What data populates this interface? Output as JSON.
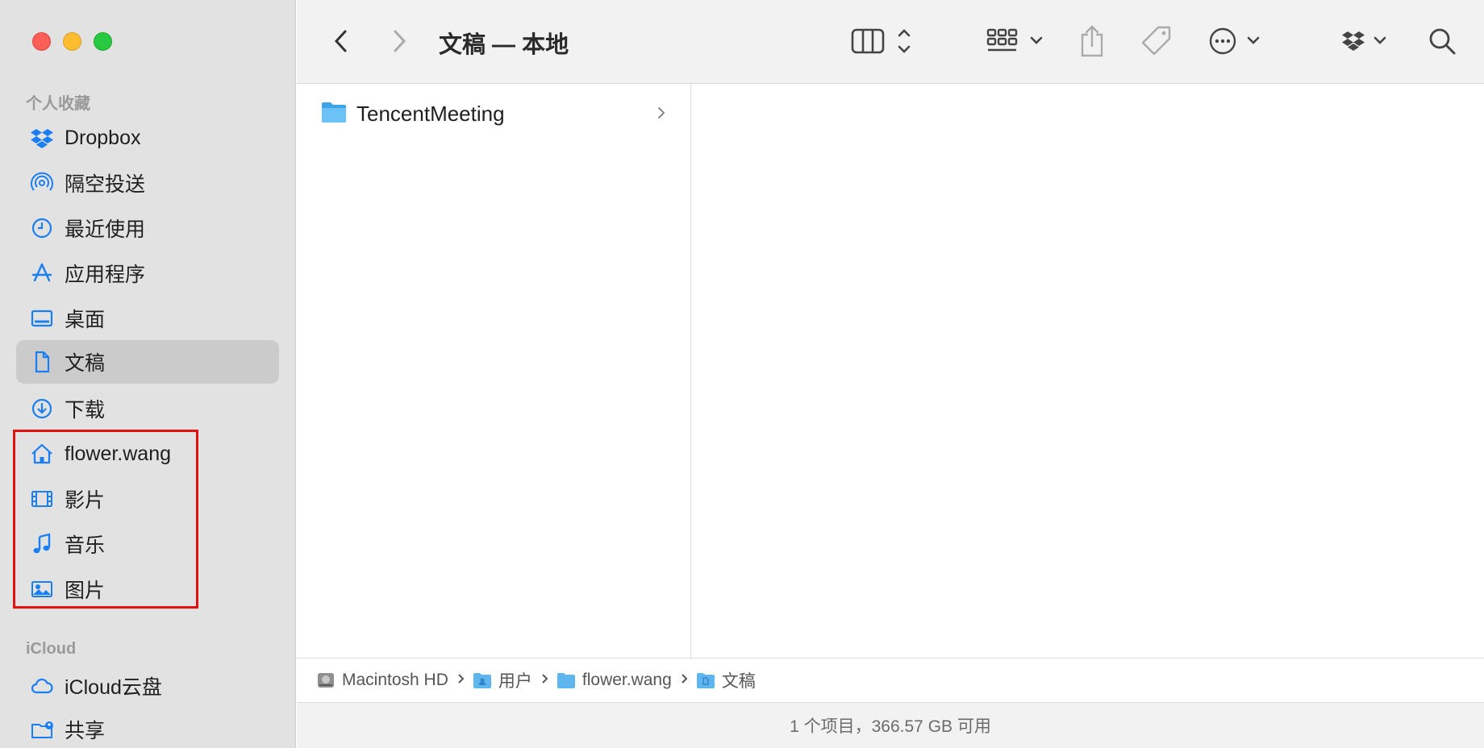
{
  "window": {
    "title": "文稿 — 本地"
  },
  "sidebar": {
    "favorites_title": "个人收藏",
    "favorites": [
      {
        "label": "Dropbox",
        "icon": "dropbox-icon"
      },
      {
        "label": "隔空投送",
        "icon": "airdrop-icon"
      },
      {
        "label": "最近使用",
        "icon": "clock-icon"
      },
      {
        "label": "应用程序",
        "icon": "apps-icon"
      },
      {
        "label": "桌面",
        "icon": "desktop-icon"
      },
      {
        "label": "文稿",
        "icon": "document-icon",
        "selected": true
      },
      {
        "label": "下载",
        "icon": "download-icon"
      },
      {
        "label": "flower.wang",
        "icon": "home-icon"
      },
      {
        "label": "影片",
        "icon": "film-icon"
      },
      {
        "label": "音乐",
        "icon": "music-icon"
      },
      {
        "label": "图片",
        "icon": "photo-icon"
      }
    ],
    "icloud_title": "iCloud",
    "icloud": [
      {
        "label": "iCloud云盘",
        "icon": "cloud-icon"
      },
      {
        "label": "共享",
        "icon": "shared-folder-icon"
      }
    ]
  },
  "content": {
    "items": [
      {
        "name": "TencentMeeting",
        "icon": "folder-icon"
      }
    ]
  },
  "pathbar": {
    "crumbs": [
      "Macintosh HD",
      "用户",
      "flower.wang",
      "文稿"
    ]
  },
  "status": {
    "text": "1 个项目，366.57 GB 可用"
  },
  "colors": {
    "accent": "#1a7ff2",
    "highlight": "#e11111",
    "sidebar_bg": "#e2e2e2"
  }
}
